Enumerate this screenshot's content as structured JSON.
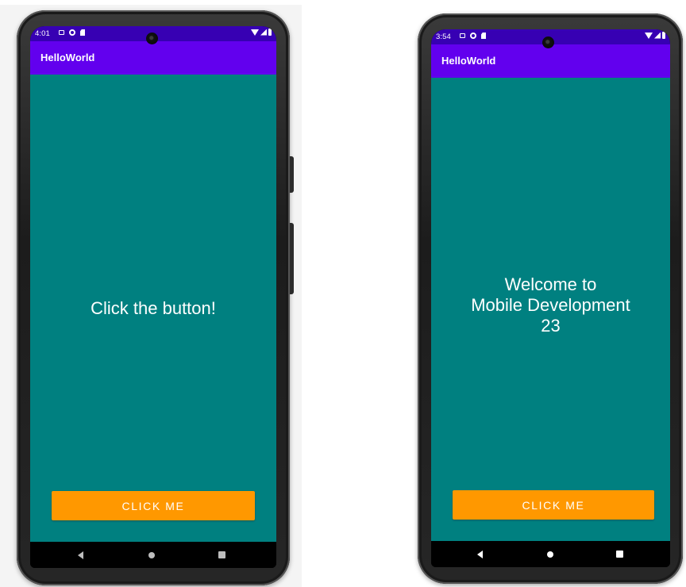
{
  "left_phone": {
    "status_time": "4:01",
    "app_title": "HelloWorld",
    "message": "Click the button!",
    "button_label": "CLICK ME"
  },
  "right_phone": {
    "status_time": "3:54",
    "app_title": "HelloWorld",
    "message": "Welcome to\nMobile Development\n23",
    "button_label": "CLICK ME"
  },
  "colors": {
    "status_bar": "#3700b3",
    "app_bar": "#6200ee",
    "content_background": "#008080",
    "button": "#ff9800",
    "text": "#ffffff"
  },
  "icons": {
    "status": [
      "message-icon",
      "sync-icon",
      "sd-card-icon",
      "wifi-icon",
      "signal-icon",
      "battery-icon"
    ],
    "navigation": [
      "back-icon",
      "home-icon",
      "recents-icon"
    ]
  }
}
